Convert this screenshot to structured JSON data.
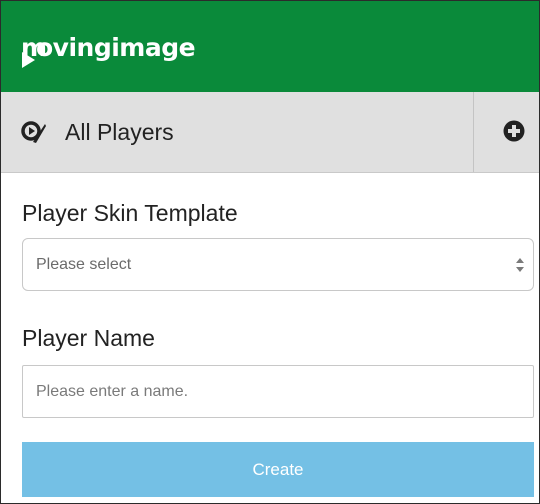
{
  "header": {
    "logo_text": "movingimage",
    "logo_rest": "ovingimage",
    "logo_first": "m",
    "brand_color": "#0a8a3a"
  },
  "players_bar": {
    "label": "All Players",
    "icon": "players-icon",
    "add_icon": "plus-circle-icon"
  },
  "form": {
    "skin_template": {
      "label": "Player Skin Template",
      "selected": "Please select"
    },
    "player_name": {
      "label": "Player Name",
      "placeholder": "Please enter a name.",
      "value": ""
    },
    "create_button": {
      "label": "Create",
      "color": "#74c0e5"
    }
  }
}
